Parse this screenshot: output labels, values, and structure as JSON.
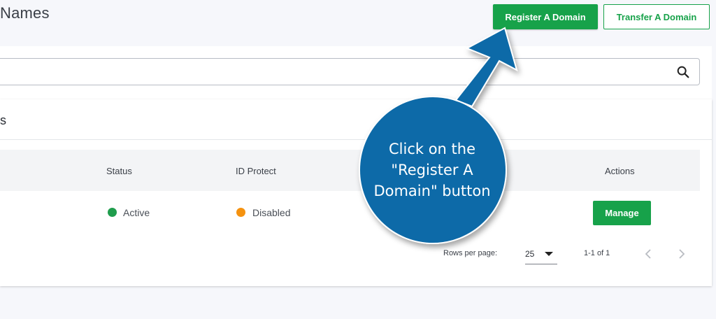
{
  "header": {
    "title": "Names",
    "register_label": "Register A Domain",
    "transfer_label": "Transfer A Domain"
  },
  "search": {
    "value": "",
    "placeholder": ""
  },
  "table": {
    "card_title": "s",
    "columns": {
      "status": "Status",
      "id_protect": "ID Protect",
      "actions": "Actions"
    },
    "rows": [
      {
        "status": "Active",
        "status_color": "#1f9d4d",
        "id_protect": "Disabled",
        "id_protect_color": "#f5920f",
        "action": "Manage"
      }
    ]
  },
  "pagination": {
    "rows_per_page_label": "Rows per page:",
    "rows_per_page_value": "25",
    "range": "1-1 of 1"
  },
  "annotation": {
    "lines": [
      "Click on the",
      "\"Register A",
      "Domain\" button"
    ],
    "color": "#0e6ba8"
  },
  "colors": {
    "accent": "#17a24a",
    "background": "#f6f7fb"
  }
}
